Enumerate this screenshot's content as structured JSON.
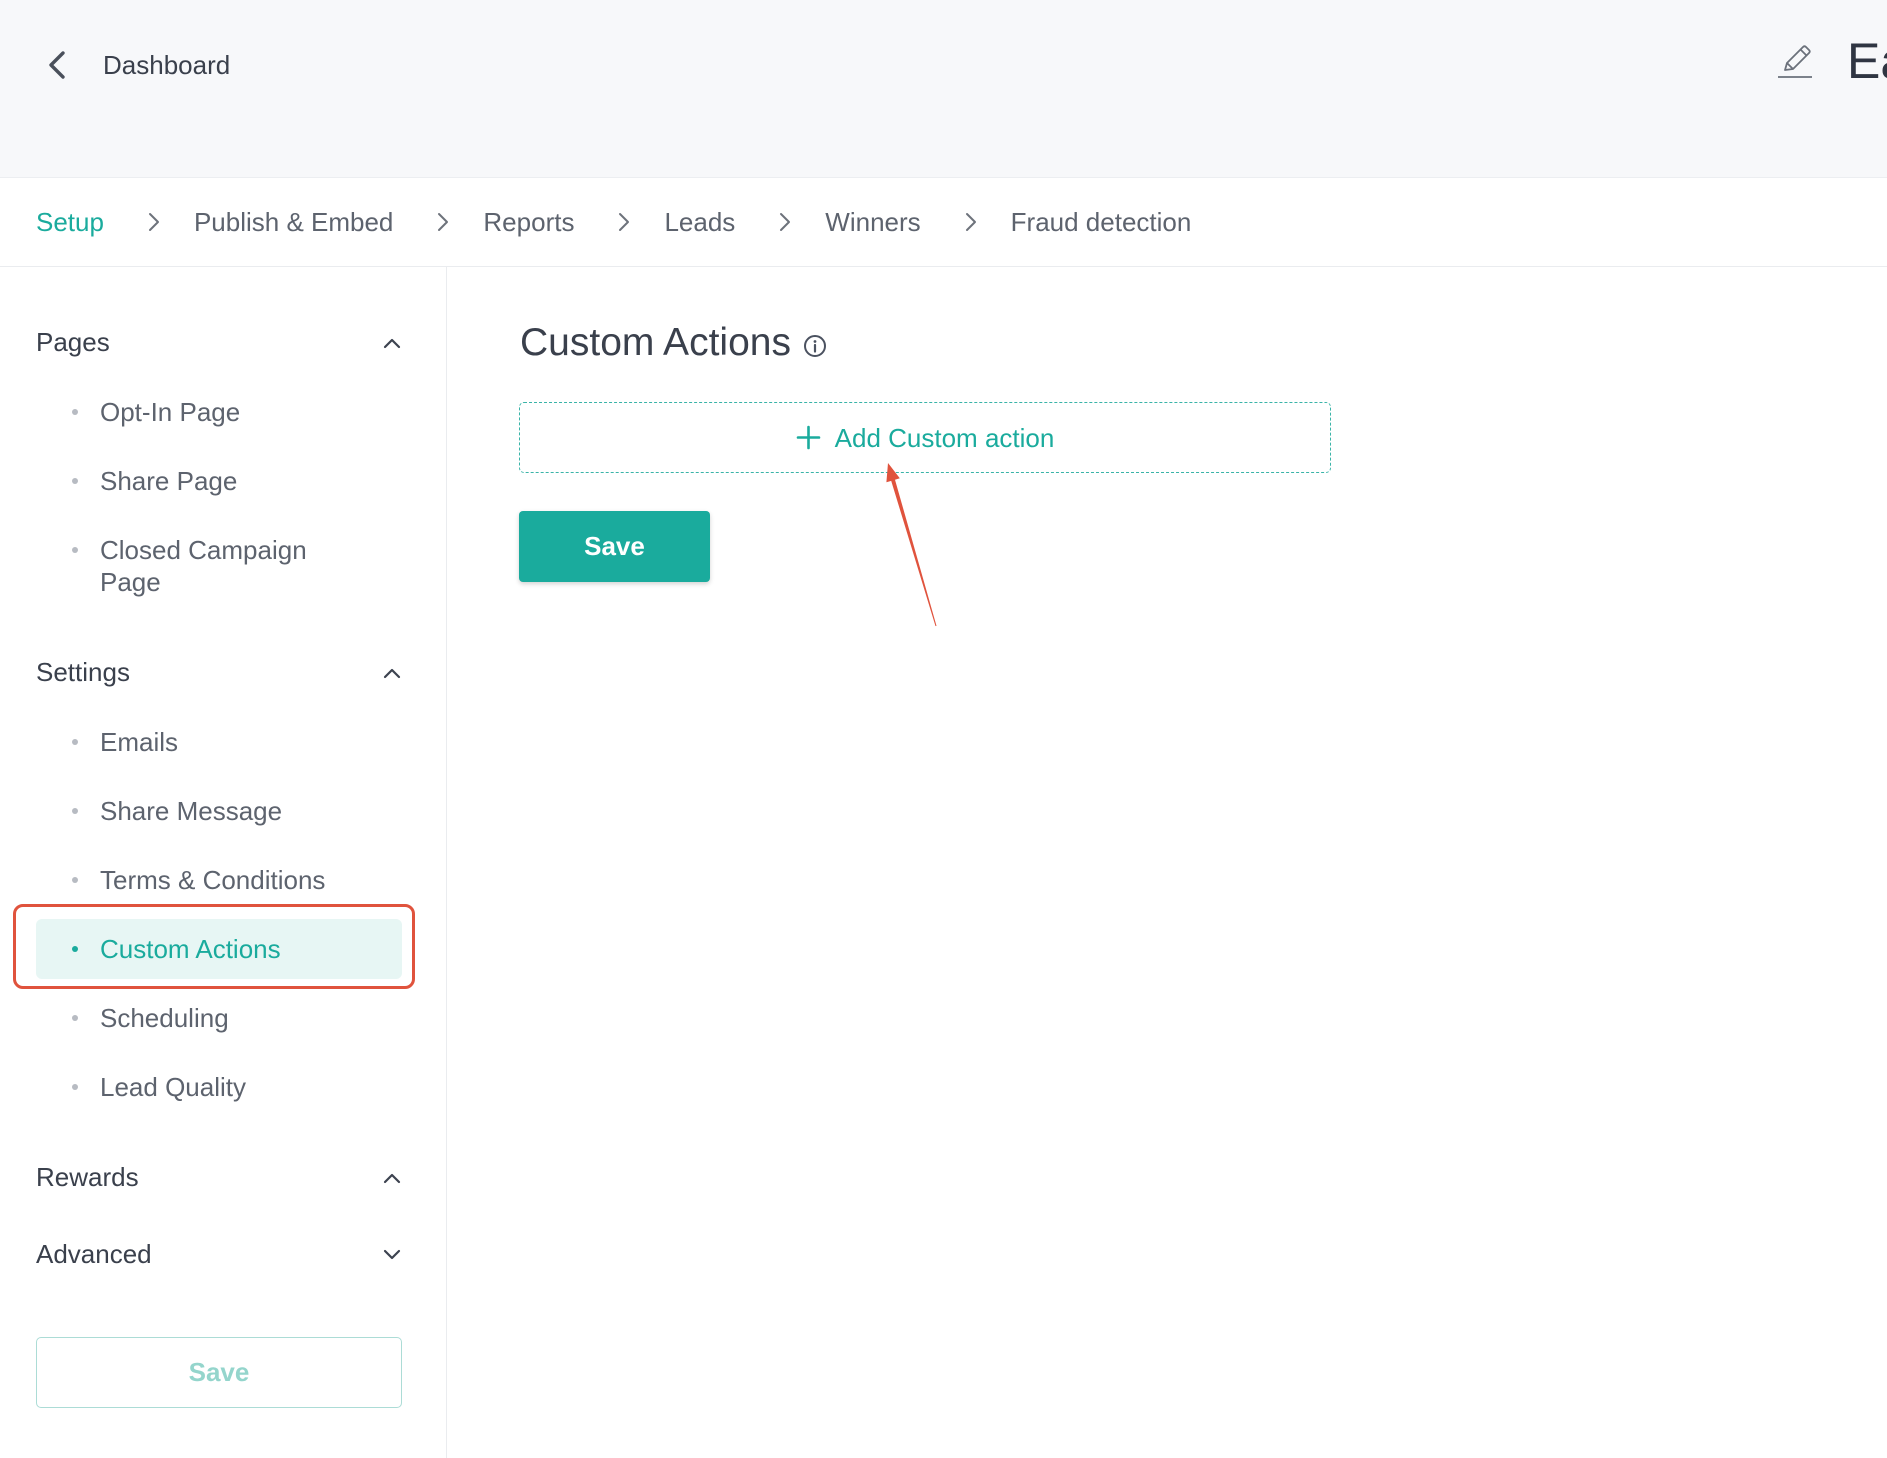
{
  "header": {
    "back_label": "Dashboard",
    "back_icon": "chevron-left-icon",
    "edit_icon": "pencil-edit-icon",
    "title": "Ea"
  },
  "tabs": [
    {
      "label": "Setup",
      "active": true
    },
    {
      "label": "Publish & Embed",
      "active": false
    },
    {
      "label": "Reports",
      "active": false
    },
    {
      "label": "Leads",
      "active": false
    },
    {
      "label": "Winners",
      "active": false
    },
    {
      "label": "Fraud detection",
      "active": false
    }
  ],
  "tab_separator_icon": "chevron-right-icon",
  "sidebar": {
    "sections": [
      {
        "title": "Pages",
        "toggle_icon": "chevron-up-icon",
        "items": [
          {
            "label": "Opt-In Page",
            "active": false
          },
          {
            "label": "Share Page",
            "active": false
          },
          {
            "label": "Closed Campaign Page",
            "active": false
          }
        ]
      },
      {
        "title": "Settings",
        "toggle_icon": "chevron-up-icon",
        "items": [
          {
            "label": "Emails",
            "active": false
          },
          {
            "label": "Share Message",
            "active": false
          },
          {
            "label": "Terms & Conditions",
            "active": false
          },
          {
            "label": "Custom Actions",
            "active": true
          },
          {
            "label": "Scheduling",
            "active": false
          },
          {
            "label": "Lead Quality",
            "active": false
          }
        ]
      },
      {
        "title": "Rewards",
        "toggle_icon": "chevron-up-icon",
        "items": []
      },
      {
        "title": "Advanced",
        "toggle_icon": "chevron-down-icon",
        "items": []
      }
    ],
    "save_label": "Save"
  },
  "main": {
    "title": "Custom Actions",
    "info_icon": "info-icon",
    "add_action": {
      "label": "Add Custom action",
      "icon": "plus-icon"
    },
    "save_label": "Save"
  },
  "colors": {
    "accent": "#1aab9d",
    "active_item_bg": "#e7f6f4",
    "header_bg": "#f7f8fa",
    "text_primary": "#3a404c",
    "text_secondary": "#5d636e",
    "annotation": "#e0533d"
  }
}
